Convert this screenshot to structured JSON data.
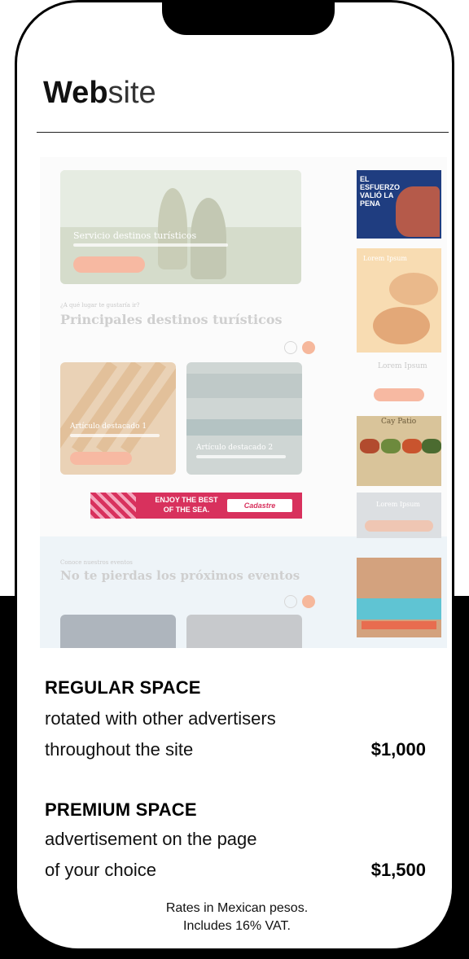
{
  "header": {
    "title_bold": "Web",
    "title_light": "site"
  },
  "preview": {
    "hero_title": "Servicio destinos turísticos",
    "section_kicker": "¿A qué lugar te gustaría ir?",
    "section_title": "Principales destinos turísticos",
    "article1_title": "Artículo destacado 1",
    "article2_title": "Artículo destacado 2",
    "banner_text": "ENJOY THE BEST OF THE SEA.",
    "banner_brand": "Cadastre",
    "events_kicker": "Conoce nuestros eventos",
    "events_title": "No te pierdas los próximos eventos",
    "ad1_text": "EL ESFUERZO VALIÓ LA PENA",
    "ad2_title": "Lorem Ipsum",
    "ad3_title": "Cay Patio",
    "ad4_title": "Lorem Ipsum"
  },
  "plans": [
    {
      "name": "REGULAR SPACE",
      "line1": "rotated with other advertisers",
      "line2": "throughout the site",
      "price": "$1,000"
    },
    {
      "name": "PREMIUM SPACE",
      "line1": "advertisement on the page",
      "line2": "of your choice",
      "price": "$1,500"
    }
  ],
  "footnote": {
    "line1": "Rates in Mexican pesos.",
    "line2": "Includes 16% VAT."
  }
}
